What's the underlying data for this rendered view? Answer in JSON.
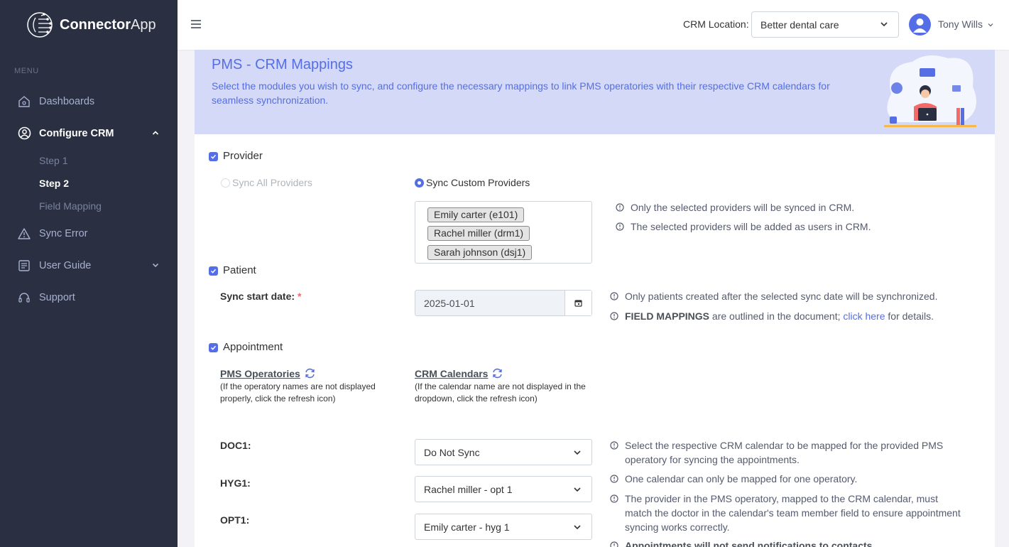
{
  "app": {
    "brand_bold": "Connector",
    "brand_light": "App"
  },
  "sidebar": {
    "menu_title": "MENU",
    "items": [
      {
        "label": "Dashboards",
        "icon": "home-icon"
      },
      {
        "label": "Configure CRM",
        "icon": "user-circle-icon",
        "active": true
      },
      {
        "label": "Sync Error",
        "icon": "warning-icon"
      },
      {
        "label": "User Guide",
        "icon": "document-icon"
      },
      {
        "label": "Support",
        "icon": "headset-icon"
      }
    ],
    "subitems": [
      {
        "label": "Step 1"
      },
      {
        "label": "Step 2",
        "active": true
      },
      {
        "label": "Field Mapping"
      }
    ]
  },
  "header": {
    "crm_location_label": "CRM Location:",
    "crm_location_value": "Better dental care",
    "user_name": "Tony Wills"
  },
  "banner": {
    "title": "PMS - CRM Mappings",
    "description": "Select the modules you wish to sync, and configure the necessary mappings to link PMS operatories with their respective CRM calendars for seamless synchronization."
  },
  "provider": {
    "label": "Provider",
    "checked": true,
    "option_all": "Sync All Providers",
    "option_custom": "Sync Custom Providers",
    "selected_option": "custom",
    "tags": [
      "Emily carter (e101)",
      "Rachel miller (drm1)",
      "Sarah johnson (dsj1)"
    ],
    "info": [
      "Only the selected providers will be synced in CRM.",
      "The selected providers will be added as users in CRM."
    ]
  },
  "patient": {
    "label": "Patient",
    "checked": true,
    "sync_start_label": "Sync start date:",
    "required_mark": "*",
    "sync_start_value": "2025-01-01",
    "info1": "Only patients created after the selected sync date will be synchronized.",
    "info2_bold": "FIELD MAPPINGS",
    "info2_mid": " are outlined in the document; ",
    "info2_link": "click here",
    "info2_end": " for details."
  },
  "appointment": {
    "label": "Appointment",
    "checked": true,
    "pms_head": "PMS Operatories",
    "pms_note": "(If the operatory names are not displayed properly, click the refresh icon)",
    "crm_head": "CRM Calendars",
    "crm_note": "(If the calendar name are not displayed in the dropdown, click the refresh icon)",
    "rows": [
      {
        "operatory": "DOC1:",
        "calendar": "Do Not Sync"
      },
      {
        "operatory": "HYG1:",
        "calendar": "Rachel miller - opt 1"
      },
      {
        "operatory": "OPT1:",
        "calendar": "Emily carter - hyg 1"
      }
    ],
    "info": [
      "Select the respective CRM calendar to be mapped for the provided PMS operatory for syncing the appointments.",
      "One calendar can only be mapped for one operatory.",
      "The provider in the PMS operatory, mapped to the CRM calendar, must match the doctor in the calendar's team member field to ensure appointment syncing works correctly.",
      "Appointments will not send notifications to contacts."
    ]
  },
  "colors": {
    "accent": "#556ee6",
    "sidebar_bg": "#2a3042",
    "banner_bg": "#d3d9f7"
  }
}
